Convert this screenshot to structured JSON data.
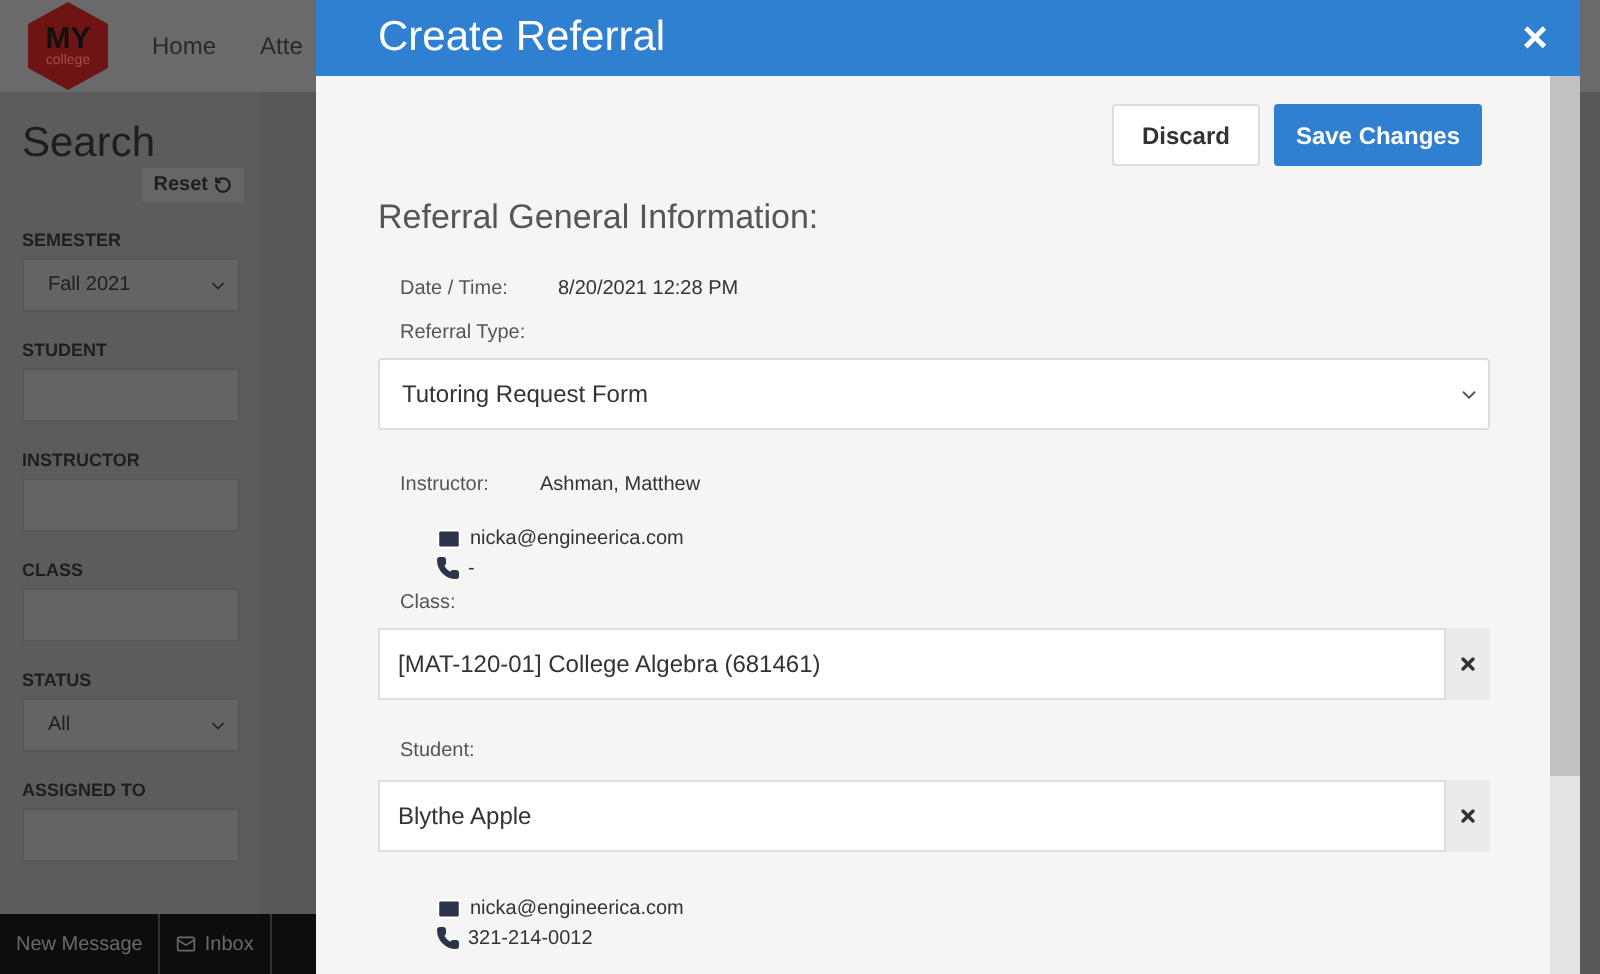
{
  "app": {
    "logo": {
      "main": "MY",
      "sub": "college"
    },
    "nav": [
      "Home",
      "Atte"
    ]
  },
  "sidebar": {
    "title": "Search",
    "reset": "Reset",
    "filters": [
      {
        "kind": "select",
        "label": "SEMESTER",
        "value": "Fall 2021"
      },
      {
        "kind": "text",
        "label": "STUDENT"
      },
      {
        "kind": "text",
        "label": "INSTRUCTOR"
      },
      {
        "kind": "text",
        "label": "CLASS"
      },
      {
        "kind": "select",
        "label": "STATUS",
        "value": "All"
      },
      {
        "kind": "text",
        "label": "ASSIGNED TO"
      }
    ]
  },
  "bottom_bar": {
    "new_message": "New Message",
    "inbox": "Inbox"
  },
  "modal": {
    "title": "Create Referral",
    "close": "×",
    "buttons": [
      {
        "label": "Discard",
        "kind": "secondary"
      },
      {
        "label": "Save Changes",
        "kind": "primary"
      }
    ],
    "section_title": "Referral General Information:",
    "date_label": "Date / Time:",
    "date_value": "8/20/2021 12:28 PM",
    "type_label": "Referral Type:",
    "type_value": "Tutoring Request Form",
    "instructor_label": "Instructor:",
    "instructor_value": "Ashman, Matthew",
    "instructor_contact": {
      "email": "nicka@engineerica.com",
      "phone": "-"
    },
    "class_label": "Class:",
    "class_value": "[MAT-120-01] College Algebra (681461)",
    "student_label": "Student:",
    "student_value": "Blythe Apple",
    "student_contact": {
      "email": "nicka@engineerica.com",
      "phone": "321-214-0012"
    }
  }
}
